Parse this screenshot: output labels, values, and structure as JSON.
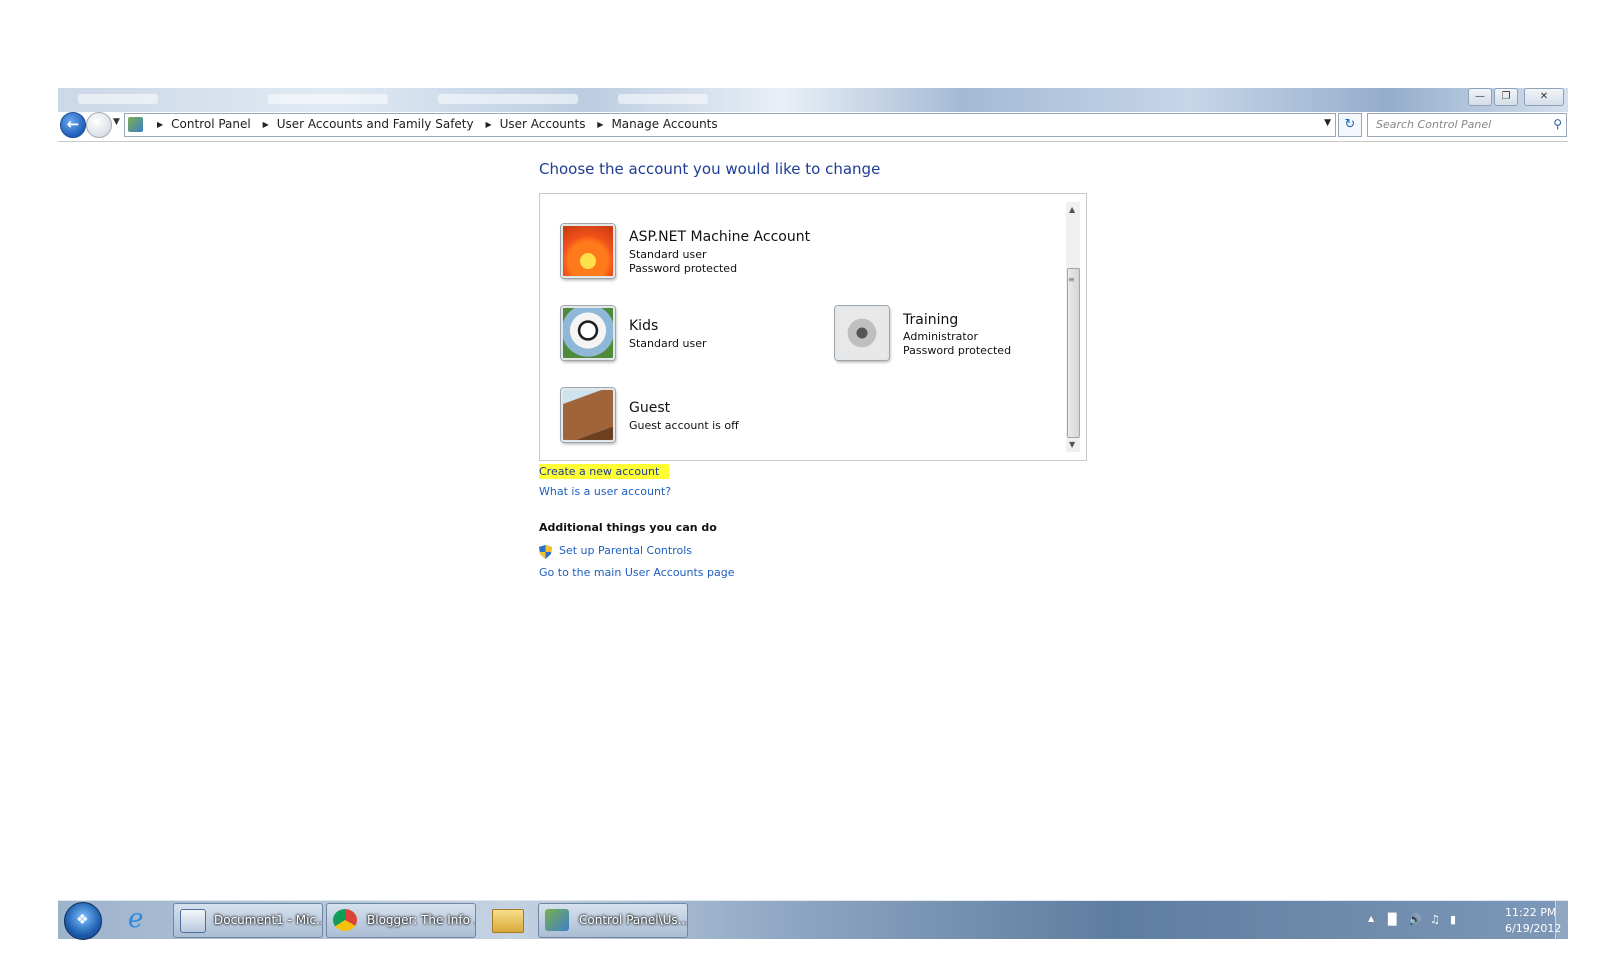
{
  "window": {
    "minimize_symbol": "—",
    "maximize_symbol": "❐",
    "close_symbol": "✕"
  },
  "nav": {
    "back_icon": "arrow-left-icon",
    "forward_icon": "arrow-right-icon",
    "breadcrumb": [
      "Control Panel",
      "User Accounts and Family Safety",
      "User Accounts",
      "Manage Accounts"
    ],
    "search_placeholder": "Search Control Panel"
  },
  "main": {
    "title": "Choose the account you would like to change",
    "accounts": [
      {
        "name": "ASP.NET Machine Account",
        "line1": "Standard user",
        "line2": "Password protected",
        "avatar": "flower-avatar"
      },
      {
        "name": "Kids",
        "line1": "Standard user",
        "line2": "",
        "avatar": "soccer-ball-avatar"
      },
      {
        "name": "Training",
        "line1": "Administrator",
        "line2": "Password protected",
        "avatar": "robot-avatar"
      },
      {
        "name": "Guest",
        "line1": "Guest account is off",
        "line2": "",
        "avatar": "briefcase-avatar"
      }
    ],
    "links": {
      "create": "Create a new account",
      "what_is": "What is a user account?"
    },
    "additional": {
      "heading": "Additional things you can do",
      "parental": "Set up Parental Controls",
      "main_page": "Go to the main User Accounts page"
    }
  },
  "taskbar": {
    "tasks": [
      {
        "label": "Document1 - Mic...",
        "icon": "word-icon"
      },
      {
        "label": "Blogger: The Info ...",
        "icon": "chrome-icon"
      },
      {
        "label": "Control Panel\\Us...",
        "icon": "control-panel-icon"
      }
    ],
    "clock_time": "11:22 PM",
    "clock_date": "6/19/2012"
  },
  "colors": {
    "title_blue": "#1e3c96",
    "link_blue": "#1e5fc0",
    "highlight": "#ffff33"
  }
}
